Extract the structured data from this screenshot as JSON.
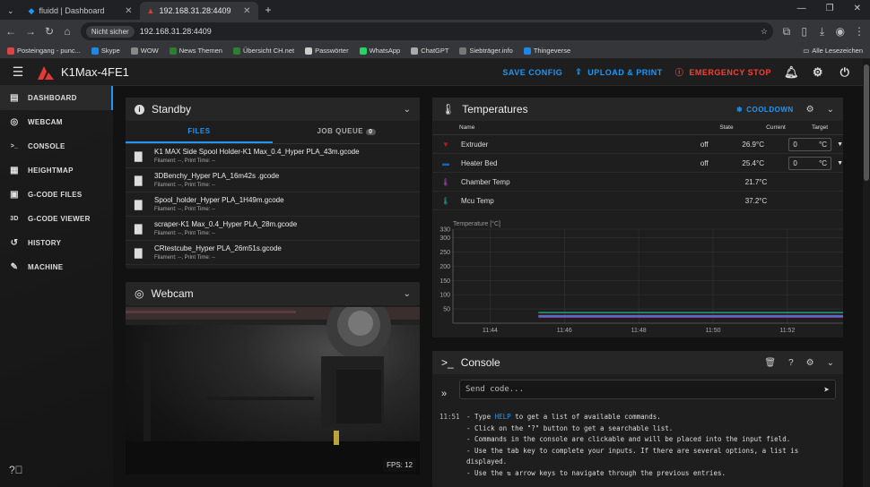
{
  "browser": {
    "tabs": [
      {
        "label": "fluidd | Dashboard",
        "active": false
      },
      {
        "label": "192.168.31.28:4409",
        "active": true
      }
    ],
    "new_tab": "+",
    "security_label": "Nicht sicher",
    "url": "192.168.31.28:4409",
    "bookmarks": [
      "Posteingang - punc...",
      "Skype",
      "WOW",
      "News Themen",
      "Übersicht CH.net",
      "Passwörter",
      "WhatsApp",
      "ChatGPT",
      "Siebträger.info",
      "Thingeverse"
    ],
    "bookmark_colors": [
      "#d44",
      "#1e88e5",
      "#888",
      "#2e7d32",
      "#2e7d32",
      "#ccc",
      "#25d366",
      "#aaa",
      "#777",
      "#1e88e5"
    ],
    "all_bookmarks": "Alle Lesezeichen"
  },
  "app": {
    "title": "K1Max-4FE1",
    "actions": {
      "save_config": "SAVE CONFIG",
      "upload_print": "UPLOAD & PRINT",
      "emergency_stop": "EMERGENCY STOP"
    },
    "accent": "#2196f3",
    "danger": "#f44336"
  },
  "sidebar": {
    "items": [
      {
        "label": "DASHBOARD",
        "icon": "dashboard-icon",
        "glyph": "▤",
        "active": true
      },
      {
        "label": "WEBCAM",
        "icon": "webcam-icon",
        "glyph": "◎",
        "active": false
      },
      {
        "label": "CONSOLE",
        "icon": "console-icon",
        "glyph": ">_",
        "active": false
      },
      {
        "label": "HEIGHTMAP",
        "icon": "heightmap-icon",
        "glyph": "▦",
        "active": false
      },
      {
        "label": "G-CODE FILES",
        "icon": "gcode-files-icon",
        "glyph": "▣",
        "active": false
      },
      {
        "label": "G-CODE VIEWER",
        "icon": "gcode-viewer-icon",
        "glyph": "3D",
        "active": false
      },
      {
        "label": "HISTORY",
        "icon": "history-icon",
        "glyph": "↺",
        "active": false
      },
      {
        "label": "MACHINE",
        "icon": "machine-icon",
        "glyph": "✎",
        "active": false
      }
    ]
  },
  "status": {
    "title": "Standby",
    "tabs": {
      "files": "FILES",
      "job_queue": "JOB QUEUE",
      "job_queue_count": "0"
    },
    "files": [
      {
        "name": "K1 MAX Side Spool Holder-K1 Max_0.4_Hyper PLA_43m.gcode",
        "meta": "Filament: --, Print Time: --"
      },
      {
        "name": "3DBenchy_Hyper PLA_16m42s .gcode",
        "meta": "Filament: --, Print Time: --"
      },
      {
        "name": "Spool_holder_Hyper PLA_1H49m.gcode",
        "meta": "Filament: --, Print Time: --"
      },
      {
        "name": "scraper-K1 Max_0.4_Hyper PLA_28m.gcode",
        "meta": "Filament: --, Print Time: --"
      },
      {
        "name": "CRtestcube_Hyper PLA_26m51s.gcode",
        "meta": "Filament: --, Print Time: --"
      }
    ]
  },
  "webcam": {
    "title": "Webcam",
    "fps": "FPS: 12"
  },
  "temperatures": {
    "title": "Temperatures",
    "cooldown": "COOLDOWN",
    "headers": {
      "name": "Name",
      "state": "State",
      "current": "Current",
      "target": "Target"
    },
    "rows": [
      {
        "name": "Extruder",
        "icon": "extruder-icon",
        "state": "off",
        "current": "26.9°C",
        "target": "0",
        "unit": "°C",
        "has_target": true,
        "color": "#b71c1c"
      },
      {
        "name": "Heater Bed",
        "icon": "heater-bed-icon",
        "state": "off",
        "current": "25.4°C",
        "target": "0",
        "unit": "°C",
        "has_target": true,
        "color": "#1565c0"
      },
      {
        "name": "Chamber Temp",
        "icon": "thermometer-icon",
        "state": "",
        "current": "21.7°C",
        "target": "",
        "unit": "",
        "has_target": false,
        "color": "#ab47bc"
      },
      {
        "name": "Mcu Temp",
        "icon": "thermometer-icon",
        "state": "",
        "current": "37.2°C",
        "target": "",
        "unit": "",
        "has_target": false,
        "color": "#26a69a"
      }
    ]
  },
  "chart_data": {
    "type": "line",
    "ylabel": "Temperature [°C]",
    "ylim": [
      0,
      330
    ],
    "yticks": [
      50,
      100,
      150,
      200,
      250,
      300,
      330
    ],
    "xticks": [
      "11:44",
      "11:46",
      "11:48",
      "11:50",
      "11:52"
    ],
    "x_range_minutes": [
      0,
      10.5
    ],
    "grid": true,
    "series": [
      {
        "name": "Mcu Temp",
        "color": "#26a69a",
        "x": [
          0,
          10.5
        ],
        "values": [
          37.2,
          37.2
        ],
        "start": 2.3
      },
      {
        "name": "Extruder",
        "color": "#c62828",
        "x": [
          0,
          10.5
        ],
        "values": [
          26.9,
          26.9
        ],
        "start": 2.3
      },
      {
        "name": "Chamber Temp",
        "color": "#ab47bc",
        "x": [
          0,
          10.5
        ],
        "values": [
          21.7,
          21.7
        ],
        "start": 2.3
      },
      {
        "name": "Heater Bed",
        "color": "#1e88e5",
        "x": [
          0,
          10.5
        ],
        "values": [
          25.4,
          25.4
        ],
        "start": 2.3
      }
    ]
  },
  "console": {
    "title": "Console",
    "placeholder": "Send code...",
    "timestamp": "11:51",
    "lines": [
      {
        "pre": "- Type ",
        "hl": "HELP",
        "post": " to get a list of available commands."
      },
      {
        "pre": "- Click on the \"?\" button to get a searchable list.",
        "hl": "",
        "post": ""
      },
      {
        "pre": "- Commands in the console are clickable and will be placed into the input field.",
        "hl": "",
        "post": ""
      },
      {
        "pre": "- Use the tab key to complete your inputs. If there are several options, a list is",
        "hl": "",
        "post": ""
      },
      {
        "pre": "displayed.",
        "hl": "",
        "post": ""
      },
      {
        "pre": "- Use the ⇅ arrow keys to navigate through the previous entries.",
        "hl": "",
        "post": ""
      }
    ]
  }
}
